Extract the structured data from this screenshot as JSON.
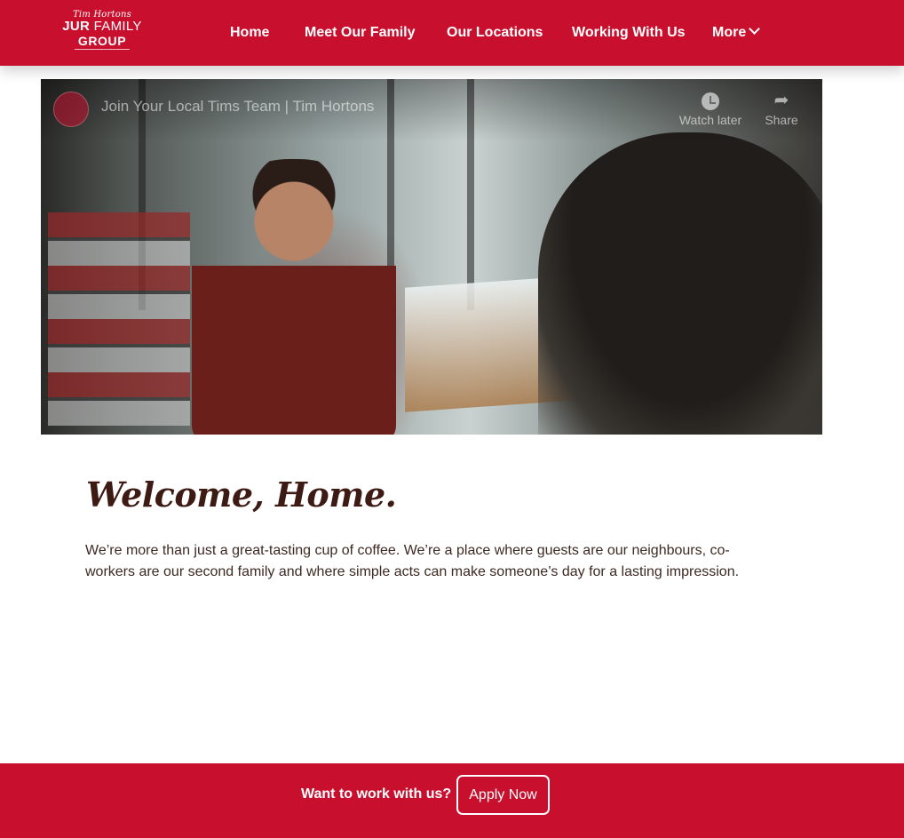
{
  "brand": {
    "logo_script": "Tim Hortons",
    "logo_line2_bold": "JUR",
    "logo_line2_thin": "FAMILY",
    "logo_line3": "GROUP",
    "primary_color": "#c8102e",
    "text_dark": "#3d1b14"
  },
  "nav": {
    "items": [
      {
        "label": "Home"
      },
      {
        "label": "Meet Our Family"
      },
      {
        "label": "Our Locations"
      },
      {
        "label": "Working With Us"
      },
      {
        "label": "More",
        "icon": "chevron-down-icon"
      }
    ]
  },
  "video": {
    "title": "Join Your Local Tims Team | Tim Hortons",
    "actions": [
      {
        "label": "Watch later",
        "icon": "clock-icon"
      },
      {
        "label": "Share",
        "icon": "share-icon"
      }
    ]
  },
  "welcome": {
    "title": "Welcome, Home.",
    "body": "We’re more than just a great-tasting cup of coffee. We’re a place where guests are our neighbours, co-workers are our second family and where simple acts can make someone’s day for a lasting impression."
  },
  "cta": {
    "text": "Want to work with us?",
    "button_label": "Apply Now"
  }
}
